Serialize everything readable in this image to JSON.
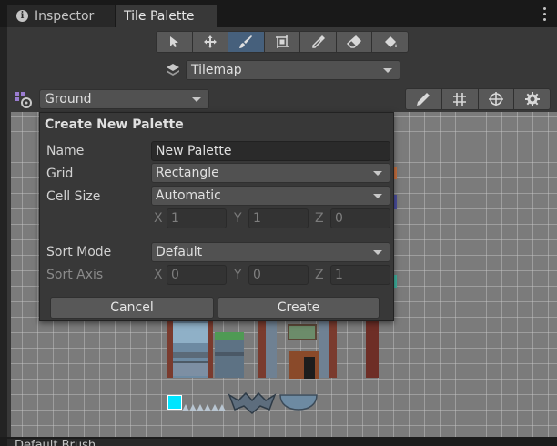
{
  "tabs": [
    {
      "label": "Inspector"
    },
    {
      "label": "Tile Palette"
    }
  ],
  "tilemap": {
    "selected": "Tilemap"
  },
  "palette": {
    "selected": "Ground"
  },
  "colors": {
    "tool_selected": "#46607c",
    "grid_bg": "#7b7b7b",
    "panel": "#383838",
    "popup": "#383838",
    "accent_tile": "#00e5ff"
  },
  "tools": [
    {
      "icon": "select-arrow-icon"
    },
    {
      "icon": "move-icon"
    },
    {
      "icon": "paintbrush-icon"
    },
    {
      "icon": "box-fill-icon"
    },
    {
      "icon": "eyedropper-icon"
    },
    {
      "icon": "eraser-icon"
    },
    {
      "icon": "fill-bucket-icon"
    }
  ],
  "right_tools": [
    {
      "icon": "edit-pencil-icon"
    },
    {
      "icon": "grid-icon"
    },
    {
      "icon": "gizmo-target-icon"
    },
    {
      "icon": "settings-gear-icon"
    }
  ],
  "dialog": {
    "title": "Create New Palette",
    "name_label": "Name",
    "name_value": "New Palette",
    "grid_label": "Grid",
    "grid_value": "Rectangle",
    "cellsize_label": "Cell Size",
    "cellsize_value": "Automatic",
    "cell_x_label": "X",
    "cell_x": "1",
    "cell_y_label": "Y",
    "cell_y": "1",
    "cell_z_label": "Z",
    "cell_z": "0",
    "sortmode_label": "Sort Mode",
    "sortmode_value": "Default",
    "sortaxis_label": "Sort Axis",
    "axis_x_label": "X",
    "axis_x": "0",
    "axis_y_label": "Y",
    "axis_y": "0",
    "axis_z_label": "Z",
    "axis_z": "1",
    "cancel_label": "Cancel",
    "create_label": "Create"
  },
  "bottom_tab": "Default Brush"
}
